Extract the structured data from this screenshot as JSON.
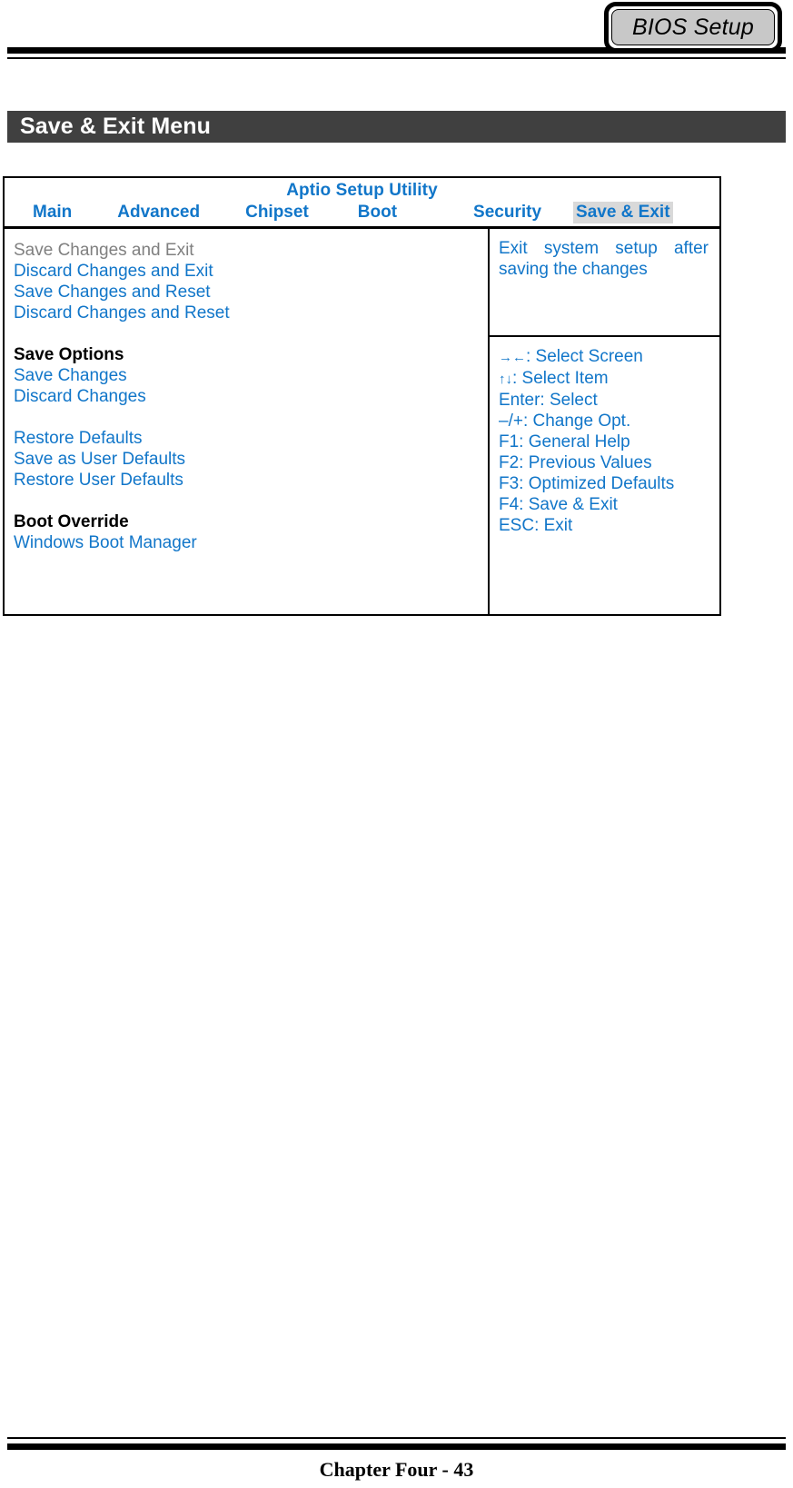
{
  "page": {
    "badge_label": "BIOS Setup",
    "section_title": "Save & Exit Menu",
    "footer": "Chapter Four - 43"
  },
  "bios": {
    "utility_title": "Aptio Setup Utility",
    "tabs": [
      {
        "label": "Main",
        "active": false
      },
      {
        "label": "Advanced",
        "active": false
      },
      {
        "label": "Chipset",
        "active": false
      },
      {
        "label": "Boot",
        "active": false
      },
      {
        "label": "Security",
        "active": false
      },
      {
        "label": "Save & Exit",
        "active": true
      }
    ],
    "menu": [
      {
        "label": "Save Changes and Exit",
        "state": "selected"
      },
      {
        "label": "Discard Changes and Exit",
        "state": "normal"
      },
      {
        "label": "Save Changes and Reset",
        "state": "normal"
      },
      {
        "label": "Discard Changes and Reset",
        "state": "normal"
      },
      {
        "label": "",
        "state": "spacer"
      },
      {
        "label": "Save Options",
        "state": "group"
      },
      {
        "label": "Save Changes",
        "state": "normal"
      },
      {
        "label": "Discard Changes",
        "state": "normal"
      },
      {
        "label": "",
        "state": "spacer"
      },
      {
        "label": "Restore Defaults",
        "state": "normal"
      },
      {
        "label": "Save as User Defaults",
        "state": "normal"
      },
      {
        "label": "Restore User Defaults",
        "state": "normal"
      },
      {
        "label": "",
        "state": "spacer"
      },
      {
        "label": "Boot Override",
        "state": "group"
      },
      {
        "label": "Windows Boot Manager",
        "state": "normal"
      }
    ],
    "help_text": "Exit system setup after saving the changes",
    "keys": [
      {
        "glyph": "→←",
        "text": ": Select Screen"
      },
      {
        "glyph": "↑↓",
        "text": ": Select Item"
      },
      {
        "glyph": "",
        "text": "Enter: Select"
      },
      {
        "glyph": "",
        "text": "–/+: Change Opt."
      },
      {
        "glyph": "",
        "text": "F1: General Help"
      },
      {
        "glyph": "",
        "text": "F2: Previous Values"
      },
      {
        "glyph": "",
        "text": "F3: Optimized Defaults"
      },
      {
        "glyph": "",
        "text": "F4: Save & Exit"
      },
      {
        "glyph": "",
        "text": "ESC: Exit"
      }
    ]
  },
  "colors": {
    "bios_blue": "#1176c9",
    "selected_gray": "#808080",
    "tab_highlight": "#d9d9d9",
    "section_bar": "#404040"
  }
}
